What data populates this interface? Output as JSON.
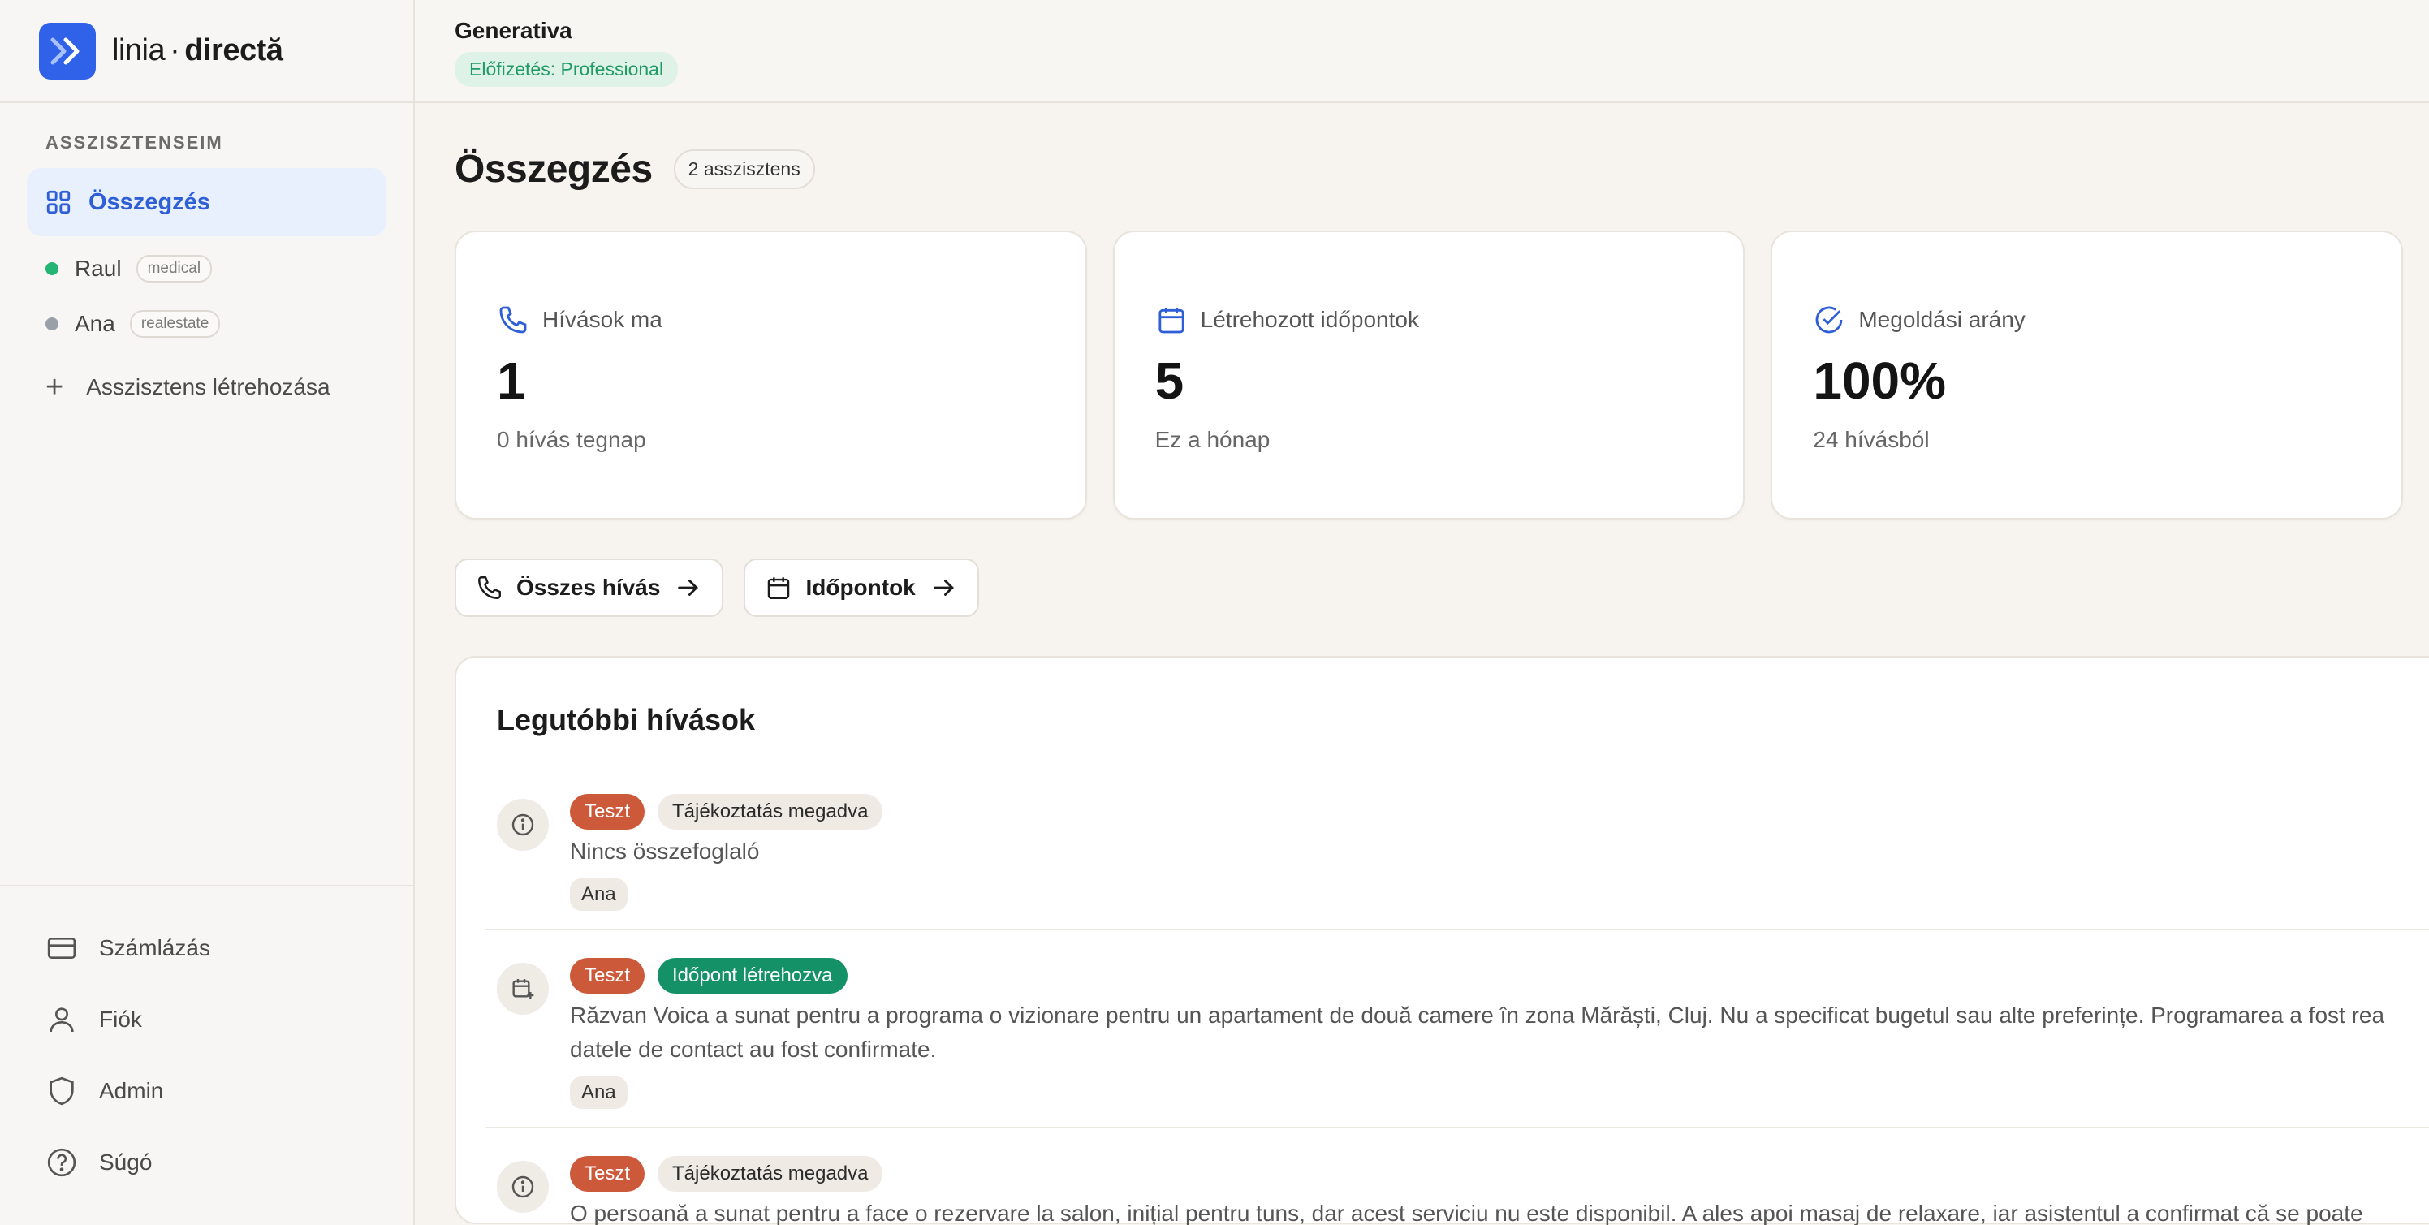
{
  "brand": {
    "name_light": "linia",
    "separator": "·",
    "name_bold": "directă"
  },
  "sidebar": {
    "section_label": "ASSZISZTENSEIM",
    "active_item": "Összegzés",
    "assistants": [
      {
        "name": "Raul",
        "tag": "medical",
        "status_color": "#22b573"
      },
      {
        "name": "Ana",
        "tag": "realestate",
        "status_color": "#9aa0a8"
      }
    ],
    "create_label": "Asszisztens létrehozása",
    "bottom": [
      {
        "label": "Számlázás",
        "icon": "credit-card-icon"
      },
      {
        "label": "Fiók",
        "icon": "user-icon"
      },
      {
        "label": "Admin",
        "icon": "shield-icon"
      },
      {
        "label": "Súgó",
        "icon": "help-circle-icon"
      }
    ]
  },
  "topbar": {
    "org_name": "Generativa",
    "plan": "Előfizetés: Professional"
  },
  "page": {
    "title": "Összegzés",
    "count_badge": "2 asszisztens"
  },
  "stats": [
    {
      "label": "Hívások ma",
      "value": "1",
      "sub": "0 hívás tegnap",
      "icon": "phone-icon"
    },
    {
      "label": "Létrehozott időpontok",
      "value": "5",
      "sub": "Ez a hónap",
      "icon": "calendar-icon"
    },
    {
      "label": "Megoldási arány",
      "value": "100%",
      "sub": "24 hívásból",
      "icon": "check-circle-icon"
    }
  ],
  "quick_links": [
    {
      "label": "Összes hívás",
      "icon": "phone-icon"
    },
    {
      "label": "Időpontok",
      "icon": "calendar-icon"
    }
  ],
  "recent": {
    "title": "Legutóbbi hívások",
    "calls": [
      {
        "icon": "info-icon",
        "badges": [
          {
            "label": "Teszt",
            "kind": "test"
          },
          {
            "label": "Tájékoztatás megadva",
            "kind": "info"
          }
        ],
        "summary_lines": [
          "Nincs összefoglaló"
        ],
        "assistant": "Ana"
      },
      {
        "icon": "calendar-plus-icon",
        "badges": [
          {
            "label": "Teszt",
            "kind": "test"
          },
          {
            "label": "Időpont létrehozva",
            "kind": "appt"
          }
        ],
        "summary_lines": [
          "Răzvan Voica a sunat pentru a programa o vizionare pentru un apartament de două camere în zona Mărăști, Cluj. Nu a specificat bugetul sau alte preferințe. Programarea a fost rea",
          "datele de contact au fost confirmate."
        ],
        "assistant": "Ana"
      },
      {
        "icon": "info-icon",
        "badges": [
          {
            "label": "Teszt",
            "kind": "test"
          },
          {
            "label": "Tájékoztatás megadva",
            "kind": "info"
          }
        ],
        "summary_lines": [
          "O persoană a sunat pentru a face o rezervare la salon, inițial pentru tuns, dar acest serviciu nu este disponibil. A ales apoi masaj de relaxare, iar asistentul a confirmat că se poate"
        ],
        "assistant": ""
      }
    ]
  }
}
